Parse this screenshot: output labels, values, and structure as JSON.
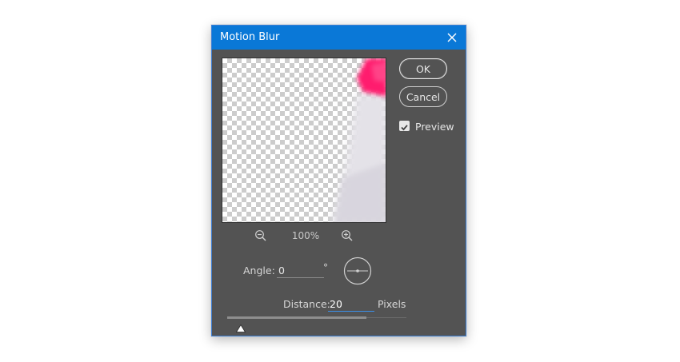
{
  "dialog": {
    "title": "Motion Blur",
    "close_icon": "close-icon"
  },
  "buttons": {
    "ok_label": "OK",
    "cancel_label": "Cancel"
  },
  "preview": {
    "label": "Preview",
    "checked": true
  },
  "zoom": {
    "level": "100%",
    "zoom_out_icon": "zoom-out-icon",
    "zoom_in_icon": "zoom-in-icon"
  },
  "angle": {
    "label": "Angle:",
    "value": "0",
    "unit": "°"
  },
  "distance": {
    "label": "Distance:",
    "value": "20",
    "unit": "Pixels",
    "slider_fraction": 0.1
  },
  "colors": {
    "titlebar": "#0a78d7",
    "panel": "#535353",
    "accent": "#3a8fe8"
  }
}
